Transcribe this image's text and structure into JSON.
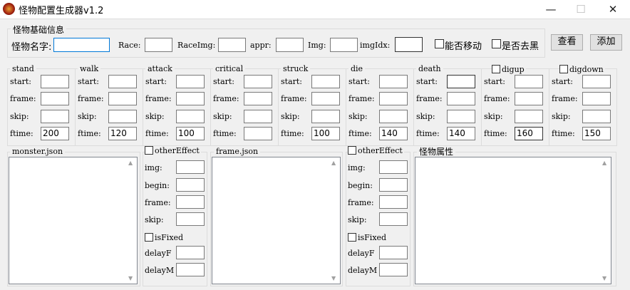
{
  "window": {
    "title": "怪物配置生成器v1.2",
    "minimize": "—",
    "maximize": "☐",
    "close": "✕"
  },
  "basic": {
    "group_label": "怪物基础信息",
    "name_label": "怪物名字:",
    "name_value": "",
    "race_label": "Race:",
    "raceimg_label": "RaceImg:",
    "appr_label": "appr:",
    "img_label": "Img:",
    "imgidx_label": "imgIdx:",
    "can_move_label": "能否移动",
    "remove_black_label": "是否去黑",
    "view_button": "查看",
    "add_button": "添加"
  },
  "field_labels": {
    "start": "start:",
    "frame": "frame:",
    "skip": "skip:",
    "ftime": "ftime:"
  },
  "actions": [
    {
      "name": "stand",
      "ftime": "200",
      "checkbox": false
    },
    {
      "name": "walk",
      "ftime": "120",
      "checkbox": false
    },
    {
      "name": "attack",
      "ftime": "100",
      "checkbox": false
    },
    {
      "name": "critical",
      "ftime": "",
      "checkbox": false
    },
    {
      "name": "struck",
      "ftime": "100",
      "checkbox": false
    },
    {
      "name": "die",
      "ftime": "140",
      "checkbox": false
    },
    {
      "name": "death",
      "ftime": "140",
      "checkbox": false
    },
    {
      "name": "digup",
      "ftime": "160",
      "checkbox": true
    },
    {
      "name": "digdown",
      "ftime": "150",
      "checkbox": true
    }
  ],
  "monster_json": {
    "label": "monster.json",
    "content": ""
  },
  "frame_json": {
    "label": "frame.json",
    "content": ""
  },
  "monster_attrs": {
    "label": "怪物属性",
    "content": ""
  },
  "other_effect": {
    "label": "otherEffect",
    "img": "img:",
    "begin": "begin:",
    "frame": "frame:",
    "skip": "skip:",
    "is_fixed": "isFixed",
    "delayF": "delayF",
    "delayM": "delayM"
  }
}
